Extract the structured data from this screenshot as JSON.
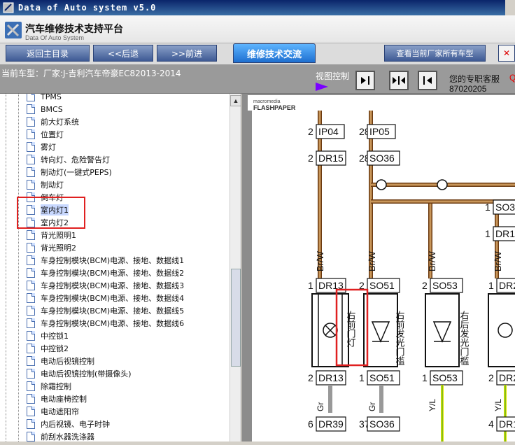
{
  "window": {
    "title": "Data of Auto system v5.0"
  },
  "header": {
    "brand": "汽车维修技术支持平台",
    "brand_sub": "Data Of Auto System"
  },
  "nav": {
    "back_main": "返回主目录",
    "back": "<<后退",
    "forward": ">>前进",
    "tab_exchange": "维修技术交流",
    "view_all": "查看当前厂家所有车型"
  },
  "status": {
    "current_model": "当前车型：厂家:J-吉利汽车帝豪EC82013-2014",
    "view_control": "视图控制",
    "expert_service": "您的专职客服",
    "expert_link": "Q",
    "phone": "87020205"
  },
  "tree": {
    "items": [
      {
        "label": "TPMS"
      },
      {
        "label": "BMCS"
      },
      {
        "label": "前大灯系统"
      },
      {
        "label": "位置灯"
      },
      {
        "label": "雾灯"
      },
      {
        "label": "转向灯、危险警告灯"
      },
      {
        "label": "制动灯(一键式PEPS)"
      },
      {
        "label": "制动灯"
      },
      {
        "label": "倒车灯"
      },
      {
        "label": "室内灯1"
      },
      {
        "label": "室内灯2"
      },
      {
        "label": "背光照明1"
      },
      {
        "label": "背光照明2"
      },
      {
        "label": "车身控制模块(BCM)电源、接地、数据线1"
      },
      {
        "label": "车身控制模块(BCM)电源、接地、数据线2"
      },
      {
        "label": "车身控制模块(BCM)电源、接地、数据线3"
      },
      {
        "label": "车身控制模块(BCM)电源、接地、数据线4"
      },
      {
        "label": "车身控制模块(BCM)电源、接地、数据线5"
      },
      {
        "label": "车身控制模块(BCM)电源、接地、数据线6"
      },
      {
        "label": "中控锁1"
      },
      {
        "label": "中控锁2"
      },
      {
        "label": "电动后视镜控制"
      },
      {
        "label": "电动后视镜控制(带摄像头)"
      },
      {
        "label": "除霜控制"
      },
      {
        "label": "电动座椅控制"
      },
      {
        "label": "电动遮阳帘"
      },
      {
        "label": "内后视镜、电子时钟"
      },
      {
        "label": "前刮水器洗涤器"
      }
    ]
  },
  "viewer": {
    "brand_small": "macromedia",
    "brand": "FLASHPAPER"
  },
  "diagram": {
    "pins_top": [
      {
        "pin": "2",
        "conn": "IP04"
      },
      {
        "pin": "28",
        "conn": "IP05"
      }
    ],
    "pins_row2": [
      {
        "pin": "2",
        "conn": "DR15"
      },
      {
        "pin": "28",
        "conn": "SO36"
      }
    ],
    "right_top": [
      {
        "pin": "1",
        "conn": "SO3"
      },
      {
        "pin": "1",
        "conn": "DR1"
      }
    ],
    "wire_labels": [
      "Br/W",
      "Br/W",
      "Br/W",
      "Br/W"
    ],
    "comp_top": [
      {
        "pin": "1",
        "conn": "DR13"
      },
      {
        "pin": "2",
        "conn": "SO51"
      },
      {
        "pin": "2",
        "conn": "SO53"
      },
      {
        "pin": "1",
        "conn": "DR2"
      }
    ],
    "comp_labels": [
      "右前门灯",
      "右前发光门槛",
      "右后发光门槛"
    ],
    "comp_bottom": [
      {
        "pin": "2",
        "conn": "DR13"
      },
      {
        "pin": "1",
        "conn": "SO51"
      },
      {
        "pin": "1",
        "conn": "SO53"
      },
      {
        "pin": "2",
        "conn": "DR2"
      }
    ],
    "bottom_wires": [
      "Gr",
      "Gr",
      "Y/L",
      "Y/L"
    ],
    "comp_bottom2": [
      {
        "pin": "6",
        "conn": "DR39"
      },
      {
        "pin": "37",
        "conn": "SO36"
      },
      {
        "pin": "4",
        "conn": "DR1"
      }
    ]
  }
}
